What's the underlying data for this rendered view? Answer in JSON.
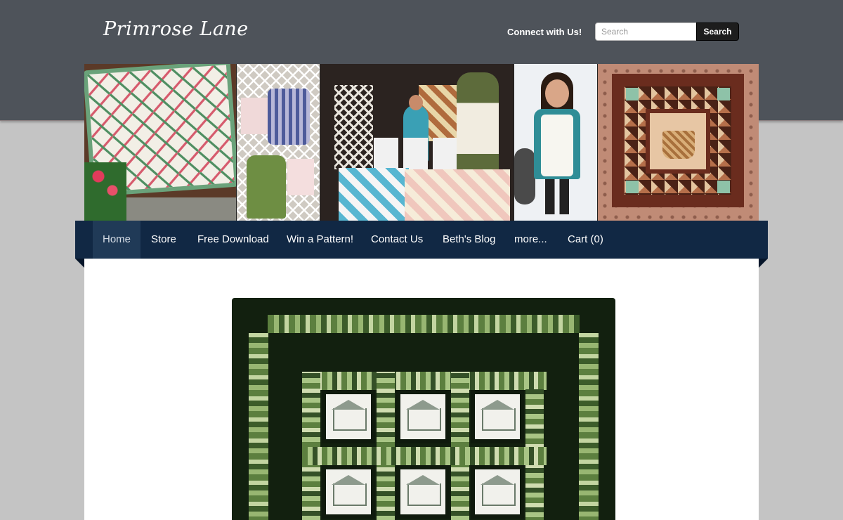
{
  "header": {
    "logo_text": "Primrose Lane",
    "connect_label": "Connect with Us!",
    "search_placeholder": "Search",
    "search_button_label": "Search"
  },
  "nav": {
    "items": [
      {
        "label": "Home",
        "active": true
      },
      {
        "label": "Store"
      },
      {
        "label": "Free Download"
      },
      {
        "label": "Win a Pattern!"
      },
      {
        "label": "Contact Us"
      },
      {
        "label": "Beth's Blog"
      },
      {
        "label": "more..."
      },
      {
        "label": "Cart (0)"
      }
    ]
  },
  "colors": {
    "header_bg": "#4e535a",
    "nav_bg": "#112844",
    "nav_active_bg": "#203a57",
    "page_bg": "#c4c4c4",
    "content_bg": "#ffffff"
  }
}
